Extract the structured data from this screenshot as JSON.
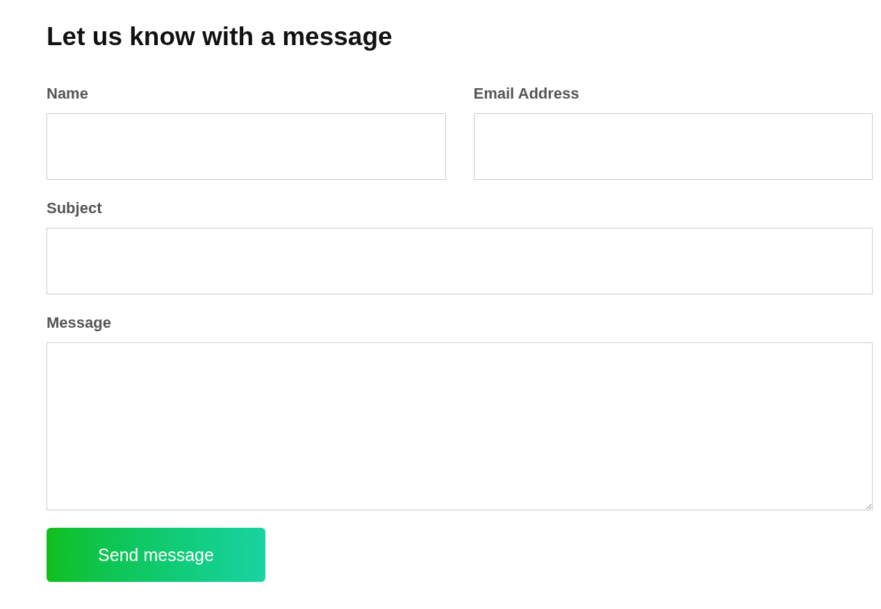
{
  "heading": "Let us know with a message",
  "rows": [
    [
      {
        "label": "Name",
        "kind": "text"
      },
      {
        "label": "Email Address",
        "kind": "text"
      }
    ],
    [
      {
        "label": "Subject",
        "kind": "text"
      }
    ],
    [
      {
        "label": "Message",
        "kind": "textarea"
      }
    ]
  ],
  "submit_button": "Send message"
}
